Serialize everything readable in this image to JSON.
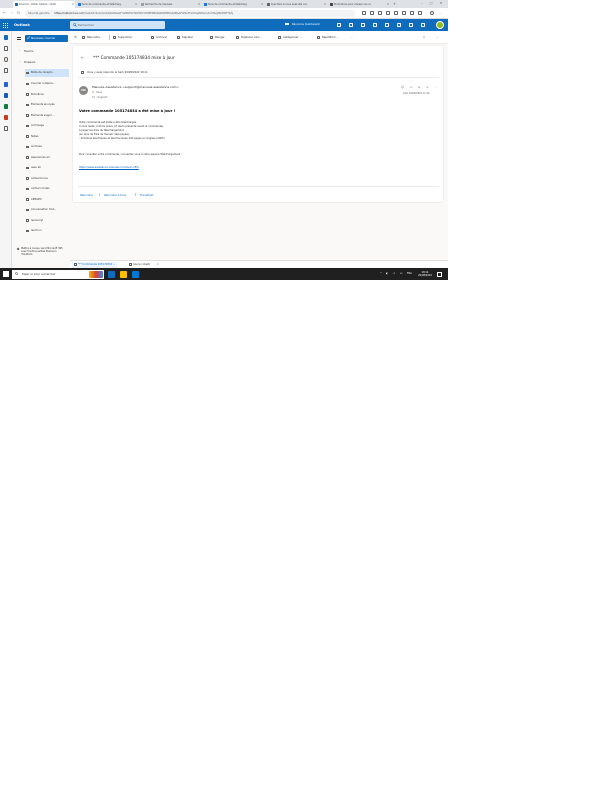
{
  "browser": {
    "tabs": [
      {
        "label": "Courrier - Didier Calmel - Outlo",
        "active": true
      },
      {
        "label": "Suivi de commande et télécharg",
        "active": false
      },
      {
        "label": "Recherche de manuels",
        "active": false
      },
      {
        "label": "Suivi de commande et télécharg",
        "active": false
      },
      {
        "label": "Que faire si vous avez été con",
        "active": false
      },
      {
        "label": "Promotions pour réviser vos co",
        "active": false
      }
    ],
    "new_tab": "+",
    "close_glyph": "✕",
    "security_label": "Sécurité garantie",
    "url_host": "https://outlook.live.com",
    "url_path": "/mail/0/inbox/id/AQQkADAwATYwMDExLTZmNmYtOWE4NS0wMAItMDAKABAAFLEbnFkx0OqeNHoAndioVNvgf6CM9TYAAJ"
  },
  "outlook": {
    "brand": "Outlook",
    "search_placeholder": "Rechercher",
    "meet_label": "Réunions maintenant"
  },
  "folders": {
    "new_mail": "Nouveau courrier",
    "favorites": "Favoris",
    "folders_section": "Dossiers",
    "items": [
      {
        "label": "Boîte de récepti...",
        "selected": true
      },
      {
        "label": "Courrier indésira...",
        "selected": false
      },
      {
        "label": "Brouillons",
        "selected": false
      },
      {
        "label": "Éléments envoyés",
        "selected": false
      },
      {
        "label": "Éléments suppri...",
        "selected": false
      },
      {
        "label": "Archivage",
        "selected": false
      },
      {
        "label": "Notes",
        "selected": false
      },
      {
        "label": "archives",
        "selected": false
      },
      {
        "label": "assurances all",
        "selected": false
      },
      {
        "label": "assu all",
        "selected": false
      },
      {
        "label": "calmel bruno",
        "selected": false
      },
      {
        "label": "calmel nicolas",
        "selected": false
      },
      {
        "label": "CREAED",
        "selected": false
      },
      {
        "label": "Conversation hist...",
        "selected": false
      },
      {
        "label": "les berryl",
        "selected": false
      },
      {
        "label": "les tirnn",
        "selected": false
      }
    ],
    "promo": "Mettre à niveau vers Microsoft 365 avec fonctionnalités Premium d'Outlook"
  },
  "commands": {
    "reply": "Répondre",
    "delete": "Supprimer",
    "archive": "Archiver",
    "report": "Signaler",
    "sweep": "Ranger",
    "move": "Déplacer vers",
    "categorize": "Catégoriser",
    "snooze": "Répétition",
    "more": "···"
  },
  "message": {
    "subject": "*** Commande 105174834 mise à jour",
    "replied_notice": "Vous y avez répondu le Sam 20/08/2022 18:11",
    "sender_initials": "MA",
    "sender": "Manuels Assistance <support@manuels-assistance.com>",
    "to": "À : Vous",
    "cc": "Cc : Support",
    "date": "Sam 20/08/2022 11:20",
    "body_title": "Votre commande 105174834 a été mise à jour !",
    "body_lines": [
      "Votre commande est prête a être téléchargée.",
      "Il vous reste, comme prévu (cf devis présenté avant la commande),",
      "à payer les frais de Téléchargement",
      "(en plus de frais de l'Avoski déjà payée).",
      "- Schémas électriques et électroniques 440 pages en Anglais (2005)"
    ],
    "body_connect": "Pour consulter votre commande, connectez vous à votre espace Téléchargement :",
    "link": "https://www.assistance-manuels.com/suivi-offre",
    "reply_btn": "Répondre",
    "reply_all_btn": "Répondre à tous",
    "forward_btn": "Transférer"
  },
  "draft_tabs": [
    {
      "label": "*** Commande 105174834 ...",
      "active": true
    },
    {
      "label": "(Aucun objet)",
      "active": false
    }
  ],
  "taskbar": {
    "search_placeholder": "Taper ici pour rechercher",
    "lang": "FRA",
    "time": "18:14",
    "date": "20/08/2022"
  },
  "colors": {
    "outlook_blue": "#0f6cbd",
    "selected_folder": "#cfe4fa",
    "taskbar": "#202020"
  }
}
